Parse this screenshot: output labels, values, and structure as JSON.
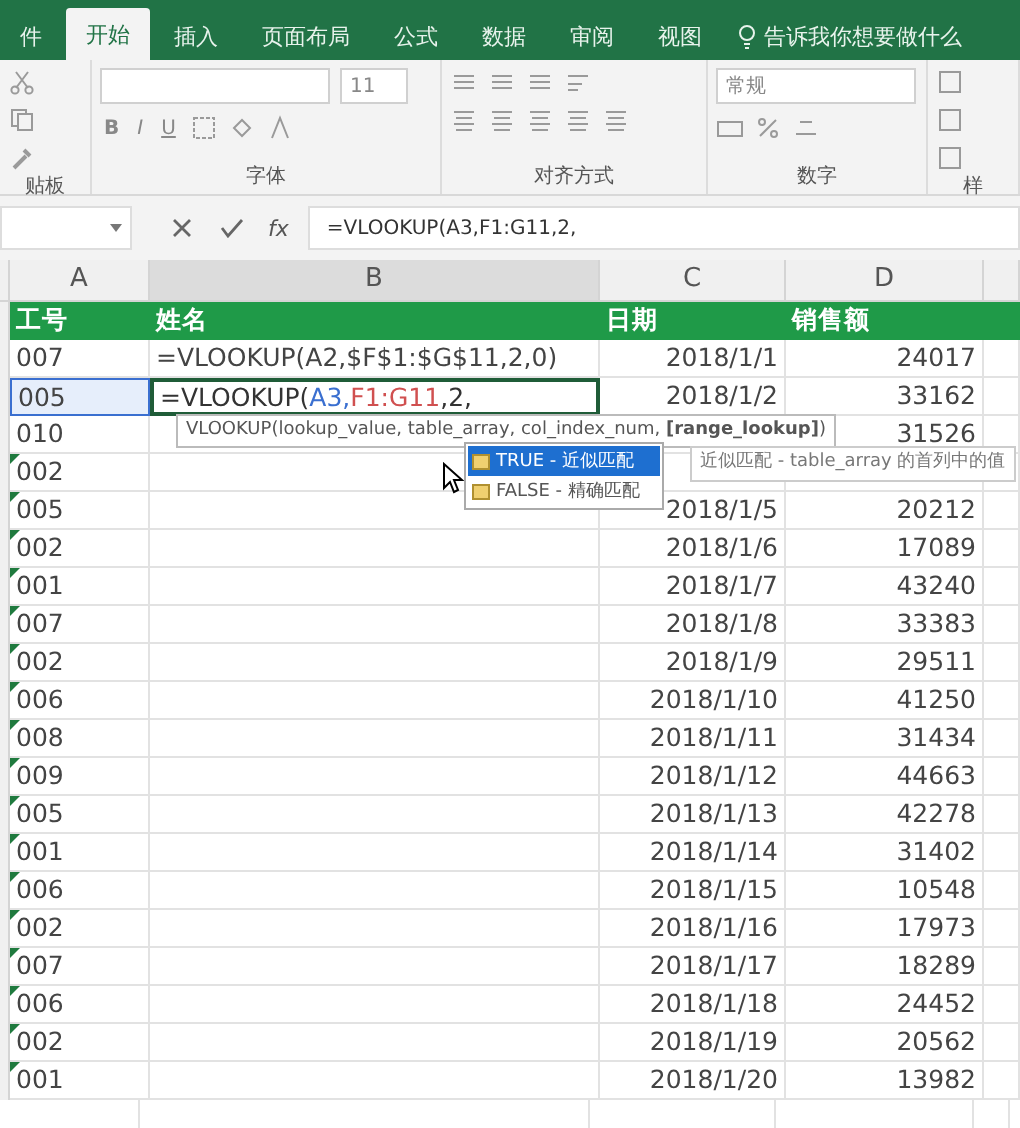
{
  "ribbon_tabs": [
    {
      "label": "件",
      "selected": false
    },
    {
      "label": "开始",
      "selected": true
    },
    {
      "label": "插入",
      "selected": false
    },
    {
      "label": "页面布局",
      "selected": false
    },
    {
      "label": "公式",
      "selected": false
    },
    {
      "label": "数据",
      "selected": false
    },
    {
      "label": "审阅",
      "selected": false
    },
    {
      "label": "视图",
      "selected": false
    }
  ],
  "tell_me": "告诉我你想要做什么",
  "ribbon": {
    "font_size": "11",
    "font_buttons": [
      "B",
      "I",
      "U"
    ],
    "number_format": "常规",
    "groups": [
      "贴板",
      "字体",
      "对齐方式",
      "数字",
      "样"
    ]
  },
  "formula_bar": {
    "function_label": "fx",
    "formula": "=VLOOKUP(A3,F1:G11,2,"
  },
  "columns": [
    {
      "label": "A",
      "selected": false
    },
    {
      "label": "B",
      "selected": true
    },
    {
      "label": "C",
      "selected": false
    },
    {
      "label": "D",
      "selected": false
    }
  ],
  "header_row": [
    "工号",
    "姓名",
    "日期",
    "销售额"
  ],
  "rows": [
    {
      "id": "007",
      "name": "=VLOOKUP(A2,$F$1:$G$11,2,0)",
      "date": "2018/1/1",
      "sales": "24017",
      "flag": false,
      "referenced": false
    },
    {
      "id": "005",
      "editing": [
        {
          "text": "=VLOOKUP(",
          "color": "#333333"
        },
        {
          "text": "A3,",
          "color": "#3a6fd0"
        },
        {
          "text": "F1:G11",
          "color": "#d05050"
        },
        {
          "text": ",2,",
          "color": "#333333"
        }
      ],
      "date": "2018/1/2",
      "sales": "33162",
      "flag": false,
      "referenced": true
    },
    {
      "id": "010",
      "sales": "31526",
      "flag": false,
      "referenced": false
    },
    {
      "id": "002",
      "flag": true,
      "referenced": false
    },
    {
      "id": "005",
      "date": "2018/1/5",
      "sales": "20212",
      "flag": true,
      "referenced": false
    },
    {
      "id": "002",
      "date": "2018/1/6",
      "sales": "17089",
      "flag": true,
      "referenced": false
    },
    {
      "id": "001",
      "date": "2018/1/7",
      "sales": "43240",
      "flag": true,
      "referenced": false
    },
    {
      "id": "007",
      "date": "2018/1/8",
      "sales": "33383",
      "flag": true,
      "referenced": false
    },
    {
      "id": "002",
      "date": "2018/1/9",
      "sales": "29511",
      "flag": true,
      "referenced": false
    },
    {
      "id": "006",
      "date": "2018/1/10",
      "sales": "41250",
      "flag": true,
      "referenced": false
    },
    {
      "id": "008",
      "date": "2018/1/11",
      "sales": "31434",
      "flag": true,
      "referenced": false
    },
    {
      "id": "009",
      "date": "2018/1/12",
      "sales": "44663",
      "flag": true,
      "referenced": false
    },
    {
      "id": "005",
      "date": "2018/1/13",
      "sales": "42278",
      "flag": true,
      "referenced": false
    },
    {
      "id": "001",
      "date": "2018/1/14",
      "sales": "31402",
      "flag": true,
      "referenced": false
    },
    {
      "id": "006",
      "date": "2018/1/15",
      "sales": "10548",
      "flag": true,
      "referenced": false
    },
    {
      "id": "002",
      "date": "2018/1/16",
      "sales": "17973",
      "flag": true,
      "referenced": false
    },
    {
      "id": "007",
      "date": "2018/1/17",
      "sales": "18289",
      "flag": true,
      "referenced": false
    },
    {
      "id": "006",
      "date": "2018/1/18",
      "sales": "24452",
      "flag": true,
      "referenced": false
    },
    {
      "id": "002",
      "date": "2018/1/19",
      "sales": "20562",
      "flag": true,
      "referenced": false
    },
    {
      "id": "001",
      "date": "2018/1/20",
      "sales": "13982",
      "flag": true,
      "referenced": false
    }
  ],
  "syntax_tooltip": "VLOOKUP(lookup_value, table_array, col_index_num, **[range_lookup]**)",
  "autocomplete": [
    {
      "label": "TRUE - 近似匹配",
      "selected": true
    },
    {
      "label": "FALSE - 精确匹配",
      "selected": false
    }
  ],
  "autocomplete_description": "近似匹配 - table_array 的首列中的值"
}
